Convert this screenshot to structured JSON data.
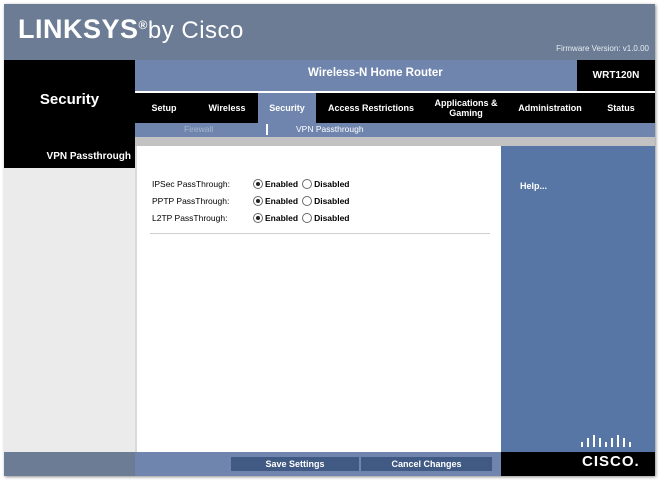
{
  "brand": {
    "name": "LINKSYS",
    "suffix": "by Cisco",
    "registered": "®"
  },
  "firmware": "Firmware Version: v1.0.00",
  "product": {
    "name": "Wireless-N Home Router",
    "model": "WRT120N"
  },
  "section_title": "Security",
  "nav": {
    "tabs": [
      {
        "label": "Setup"
      },
      {
        "label": "Wireless"
      },
      {
        "label": "Security",
        "active": true
      },
      {
        "label": "Access Restrictions"
      },
      {
        "label": "Applications & Gaming"
      },
      {
        "label": "Administration"
      },
      {
        "label": "Status"
      }
    ]
  },
  "subnav": {
    "items": [
      {
        "label": "Firewall"
      },
      {
        "label": "VPN Passthrough",
        "active": true
      }
    ]
  },
  "left_label": "VPN Passthrough",
  "settings": [
    {
      "label": "IPSec PassThrough:",
      "enabled_label": "Enabled",
      "disabled_label": "Disabled",
      "value": "Enabled"
    },
    {
      "label": "PPTP PassThrough:",
      "enabled_label": "Enabled",
      "disabled_label": "Disabled",
      "value": "Enabled"
    },
    {
      "label": "L2TP PassThrough:",
      "enabled_label": "Enabled",
      "disabled_label": "Disabled",
      "value": "Enabled"
    }
  ],
  "help": "Help...",
  "buttons": {
    "save": "Save Settings",
    "cancel": "Cancel Changes"
  },
  "cisco_logo_text": "CISCO.",
  "colors": {
    "header": "#6b7c94",
    "accent_blue": "#6f85ad",
    "help_panel": "#5776a5",
    "nav_bg": "#000000"
  }
}
